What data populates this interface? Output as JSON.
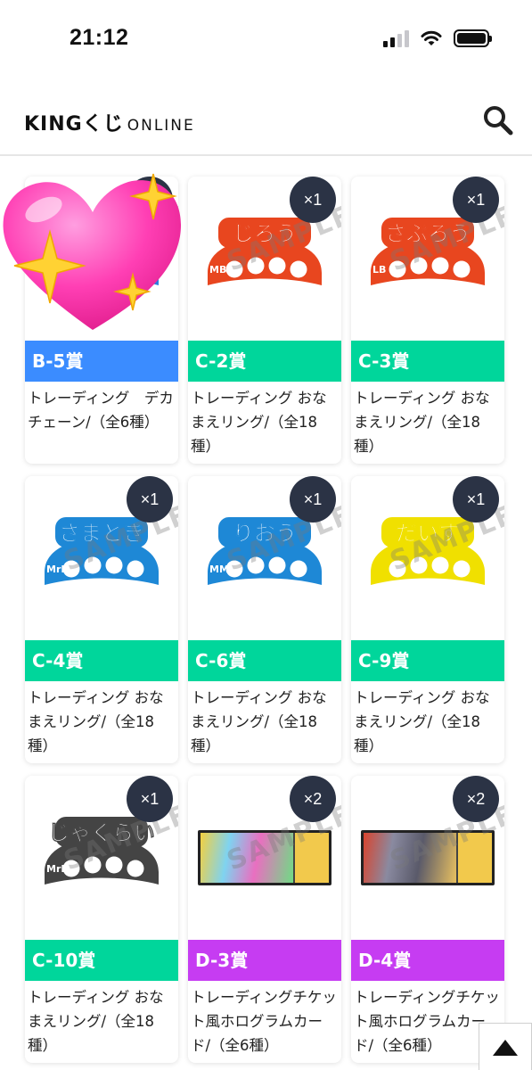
{
  "status_bar": {
    "time": "21:12",
    "signal_icon": "signal-icon",
    "wifi_icon": "wifi-icon",
    "battery_icon": "battery-icon"
  },
  "header": {
    "logo_main": "KINGくじ",
    "logo_sub": "ONLINE",
    "search_icon": "search-icon"
  },
  "colors": {
    "blue": "#3b8cff",
    "green": "#00d69b",
    "purple": "#c63cf2",
    "badge": "#2b3345"
  },
  "prizes": [
    {
      "label": "B-5賞",
      "desc": "トレーディング　デカチェーン/（全6種）",
      "count": "×1",
      "color": "#3b8cff",
      "kind": "ring",
      "ring_color": "#2a7de1",
      "ring_name": "",
      "tag": ""
    },
    {
      "label": "C-2賞",
      "desc": "トレーディング おなまえリング/（全18種）",
      "count": "×1",
      "color": "#00d69b",
      "kind": "ring",
      "ring_color": "#e8461f",
      "ring_name": "じろう",
      "tag": "MB"
    },
    {
      "label": "C-3賞",
      "desc": "トレーディング おなまえリング/（全18種）",
      "count": "×1",
      "color": "#00d69b",
      "kind": "ring",
      "ring_color": "#e8461f",
      "ring_name": "さぶろう",
      "tag": "LB"
    },
    {
      "label": "C-4賞",
      "desc": "トレーディング おなまえリング/（全18種）",
      "count": "×1",
      "color": "#00d69b",
      "kind": "ring",
      "ring_color": "#1e88d6",
      "ring_name": "さまとき",
      "tag": "MrHc"
    },
    {
      "label": "C-6賞",
      "desc": "トレーディング おなまえリング/（全18種）",
      "count": "×1",
      "color": "#00d69b",
      "kind": "ring",
      "ring_color": "#1e88d6",
      "ring_name": "りおう",
      "tag": "MM"
    },
    {
      "label": "C-9賞",
      "desc": "トレーディング おなまえリング/（全18種）",
      "count": "×1",
      "color": "#00d69b",
      "kind": "ring",
      "ring_color": "#f0e000",
      "ring_name": "だいす",
      "tag": ""
    },
    {
      "label": "C-10賞",
      "desc": "トレーディング おなまえリング/（全18種）",
      "count": "×1",
      "color": "#00d69b",
      "kind": "ring",
      "ring_color": "#444444",
      "ring_name": "じゃくらい",
      "tag": "MrDc"
    },
    {
      "label": "D-3賞",
      "desc": "トレーディングチケット風ホログラムカード/（全6種）",
      "count": "×2",
      "color": "#c63cf2",
      "kind": "ticket",
      "ticket_colors": [
        "#f4d03f",
        "#7fd3f0",
        "#e96fc0",
        "#6fdc84"
      ]
    },
    {
      "label": "D-4賞",
      "desc": "トレーディングチケット風ホログラムカード/（全6種）",
      "count": "×2",
      "color": "#c63cf2",
      "kind": "ticket",
      "ticket_colors": [
        "#d9442e",
        "#8a8aa0",
        "#5a5a6a",
        "#e8c060"
      ]
    }
  ],
  "sample_watermark": "SAMPLE",
  "scroll_top_icon": "arrow-up-icon",
  "sticker_icon": "sparkling-heart-icon"
}
